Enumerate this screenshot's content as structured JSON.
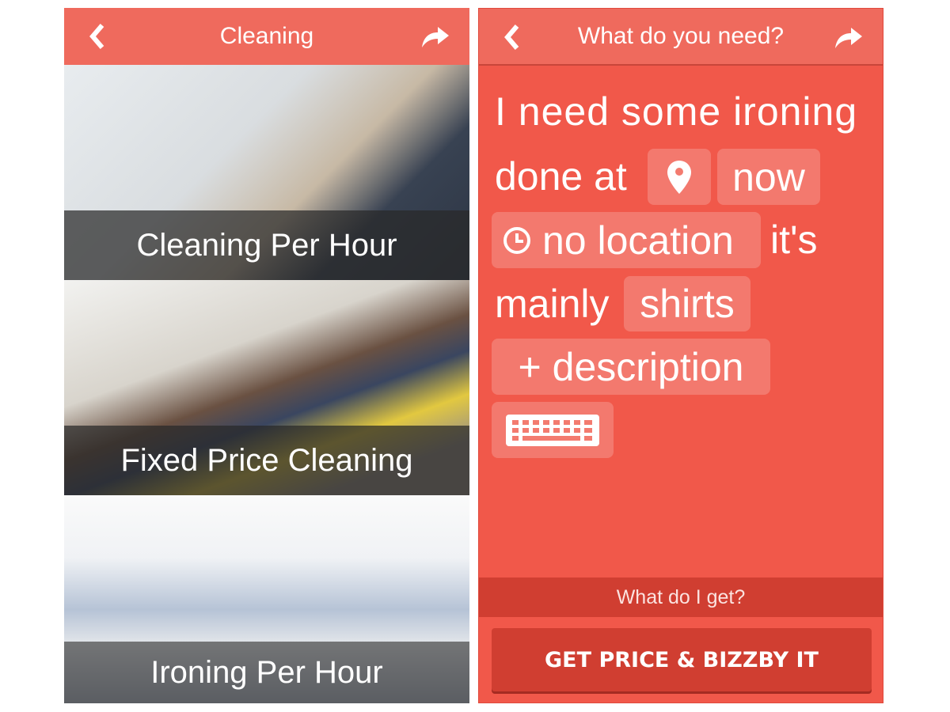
{
  "left_screen": {
    "header": {
      "title": "Cleaning",
      "back_icon": "chevron-left-icon",
      "share_icon": "share-arrow-icon"
    },
    "categories": [
      {
        "label": "Cleaning Per Hour"
      },
      {
        "label": "Fixed Price Cleaning"
      },
      {
        "label": "Ironing Per Hour"
      }
    ]
  },
  "right_screen": {
    "header": {
      "title": "What do you need?",
      "back_icon": "chevron-left-icon",
      "share_icon": "share-arrow-icon"
    },
    "sentence": {
      "line1": "I need some ironing",
      "done_at": "done at",
      "location_icon": "map-pin-icon",
      "time_chip": "now",
      "location_chip": "no location",
      "clock_icon": "clock-icon",
      "its": "it's",
      "mainly": "mainly",
      "items_chip": "shirts",
      "description_chip": "+ description",
      "keyboard_icon": "keyboard-icon"
    },
    "what_do_i_get": "What do I get?",
    "cta_label": "GET PRICE & BIZZBY IT"
  },
  "colors": {
    "brand": "#f1584a",
    "header": "#ef6a5d",
    "dark": "#d03e31"
  }
}
